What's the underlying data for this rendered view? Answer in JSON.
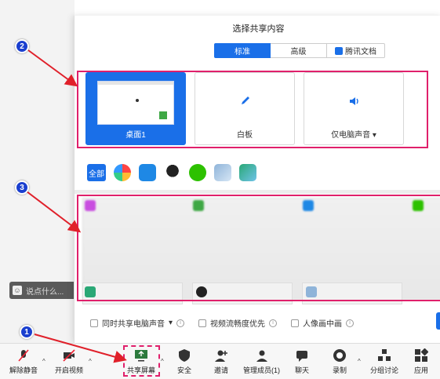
{
  "status_icons": [
    "info-icon",
    "shield-icon",
    "signal-icon"
  ],
  "chat": {
    "placeholder": "说点什么..."
  },
  "dialog": {
    "title": "选择共享内容",
    "tabs": [
      {
        "label": "标准",
        "active": true
      },
      {
        "label": "高级",
        "active": false
      },
      {
        "label": "腾讯文档",
        "active": false
      }
    ],
    "cards": [
      {
        "label": "桌面1",
        "selected": true
      },
      {
        "label": "白板",
        "selected": false
      },
      {
        "label": "仅电脑声音",
        "selected": false
      }
    ],
    "app_filter": {
      "all_label": "全部"
    },
    "options": [
      {
        "label": "同时共享电脑声音"
      },
      {
        "label": "视频流畅度优先"
      },
      {
        "label": "人像画中画"
      }
    ]
  },
  "toolbar": {
    "items": [
      {
        "label": "解除静音"
      },
      {
        "label": "开启视频"
      },
      {
        "label": "共享屏幕"
      },
      {
        "label": "安全"
      },
      {
        "label": "邀请"
      },
      {
        "label": "管理成员(1)"
      },
      {
        "label": "聊天"
      },
      {
        "label": "录制"
      },
      {
        "label": "分组讨论"
      },
      {
        "label": "应用"
      }
    ]
  },
  "markers": [
    "1",
    "2",
    "3"
  ],
  "colors": {
    "accent": "#1a6fe8",
    "highlight": "#e0206b",
    "marker": "#1a3fcf"
  }
}
